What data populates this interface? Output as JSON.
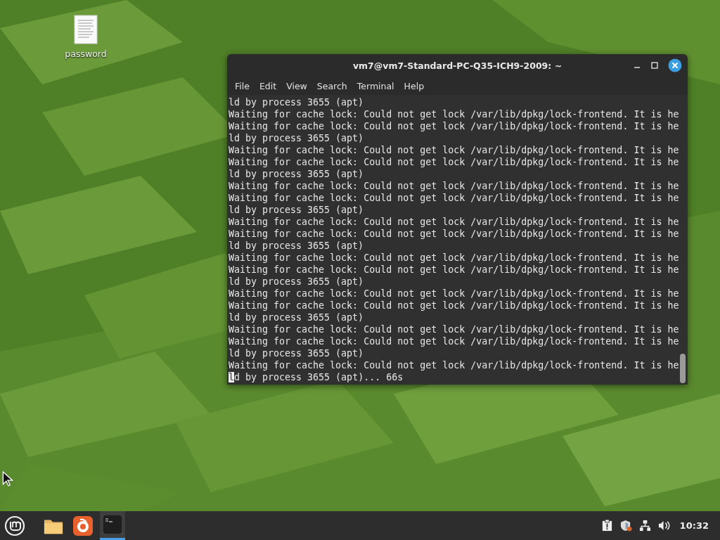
{
  "desktop_icons": [
    {
      "label": "password",
      "kind": "document"
    }
  ],
  "terminal": {
    "title": "vm7@vm7-Standard-PC-Q35-ICH9-2009: ~",
    "menu": [
      "File",
      "Edit",
      "View",
      "Search",
      "Terminal",
      "Help"
    ],
    "lines": [
      {
        "text": "ld by process 3655 (apt)",
        "cursor": false
      },
      {
        "text": "Waiting for cache lock: Could not get lock /var/lib/dpkg/lock-frontend. It is he",
        "cursor": false
      },
      {
        "text": "Waiting for cache lock: Could not get lock /var/lib/dpkg/lock-frontend. It is he",
        "cursor": false
      },
      {
        "text": "ld by process 3655 (apt)",
        "cursor": false
      },
      {
        "text": "Waiting for cache lock: Could not get lock /var/lib/dpkg/lock-frontend. It is he",
        "cursor": false
      },
      {
        "text": "Waiting for cache lock: Could not get lock /var/lib/dpkg/lock-frontend. It is he",
        "cursor": false
      },
      {
        "text": "ld by process 3655 (apt)",
        "cursor": false
      },
      {
        "text": "Waiting for cache lock: Could not get lock /var/lib/dpkg/lock-frontend. It is he",
        "cursor": false
      },
      {
        "text": "Waiting for cache lock: Could not get lock /var/lib/dpkg/lock-frontend. It is he",
        "cursor": false
      },
      {
        "text": "ld by process 3655 (apt)",
        "cursor": false
      },
      {
        "text": "Waiting for cache lock: Could not get lock /var/lib/dpkg/lock-frontend. It is he",
        "cursor": false
      },
      {
        "text": "Waiting for cache lock: Could not get lock /var/lib/dpkg/lock-frontend. It is he",
        "cursor": false
      },
      {
        "text": "ld by process 3655 (apt)",
        "cursor": false
      },
      {
        "text": "Waiting for cache lock: Could not get lock /var/lib/dpkg/lock-frontend. It is he",
        "cursor": false
      },
      {
        "text": "Waiting for cache lock: Could not get lock /var/lib/dpkg/lock-frontend. It is he",
        "cursor": false
      },
      {
        "text": "ld by process 3655 (apt)",
        "cursor": false
      },
      {
        "text": "Waiting for cache lock: Could not get lock /var/lib/dpkg/lock-frontend. It is he",
        "cursor": false
      },
      {
        "text": "Waiting for cache lock: Could not get lock /var/lib/dpkg/lock-frontend. It is he",
        "cursor": false
      },
      {
        "text": "ld by process 3655 (apt)",
        "cursor": false
      },
      {
        "text": "Waiting for cache lock: Could not get lock /var/lib/dpkg/lock-frontend. It is he",
        "cursor": false
      },
      {
        "text": "Waiting for cache lock: Could not get lock /var/lib/dpkg/lock-frontend. It is he",
        "cursor": false
      },
      {
        "text": "ld by process 3655 (apt)",
        "cursor": false
      },
      {
        "text": "Waiting for cache lock: Could not get lock /var/lib/dpkg/lock-frontend. It is he",
        "cursor": false
      },
      {
        "text": "ld by process 3655 (apt)... 66s",
        "cursor": true
      }
    ]
  },
  "taskbar": {
    "apps": [
      {
        "kind": "folder",
        "active": false
      },
      {
        "kind": "browser",
        "active": false
      },
      {
        "kind": "terminal",
        "active": true
      }
    ],
    "tray": [
      {
        "kind": "clipboard"
      },
      {
        "kind": "shield"
      },
      {
        "kind": "network"
      },
      {
        "kind": "volume"
      }
    ],
    "clock": "10:32"
  }
}
